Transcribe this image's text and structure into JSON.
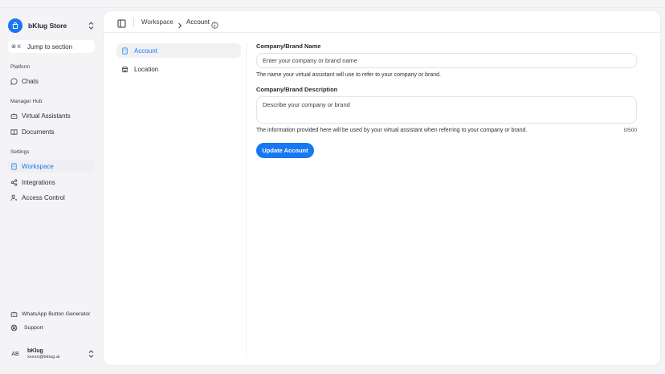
{
  "sidebar": {
    "store_name": "bKlug Store",
    "jump": {
      "shortcut": "⌘ K",
      "label": "Jump to section"
    },
    "groups": {
      "platform": "Platform",
      "manager_hub": "Manager Hub",
      "settings": "Settings"
    },
    "items": {
      "chats": "Chats",
      "virtual_assistants": "Virtual Assistants",
      "documents": "Documents",
      "workspace": "Workspace",
      "integrations": "Integrations",
      "access_control": "Access Control",
      "whatsapp": "WhatsApp Button Generator",
      "support": "Support"
    },
    "user": {
      "initials": "AB",
      "name": "bKlug",
      "email": "xxxxx@bklug.ai"
    }
  },
  "header": {
    "breadcrumb_parent": "Workspace",
    "breadcrumb_current": "Account"
  },
  "subnav": {
    "account": "Account",
    "location": "Location"
  },
  "form": {
    "name_label": "Company/Brand Name",
    "name_placeholder": "Enter your company or brand name",
    "name_help": "The name your virtual assistant will use to refer to your company or brand.",
    "desc_label": "Company/Brand Description",
    "desc_placeholder": "Describe your company or brand",
    "desc_help": "The information provided here will be used by your virtual assistant when referring to your company or brand.",
    "desc_count": "0/500",
    "submit_label": "Update Account"
  },
  "colors": {
    "accent": "#1877f2"
  }
}
